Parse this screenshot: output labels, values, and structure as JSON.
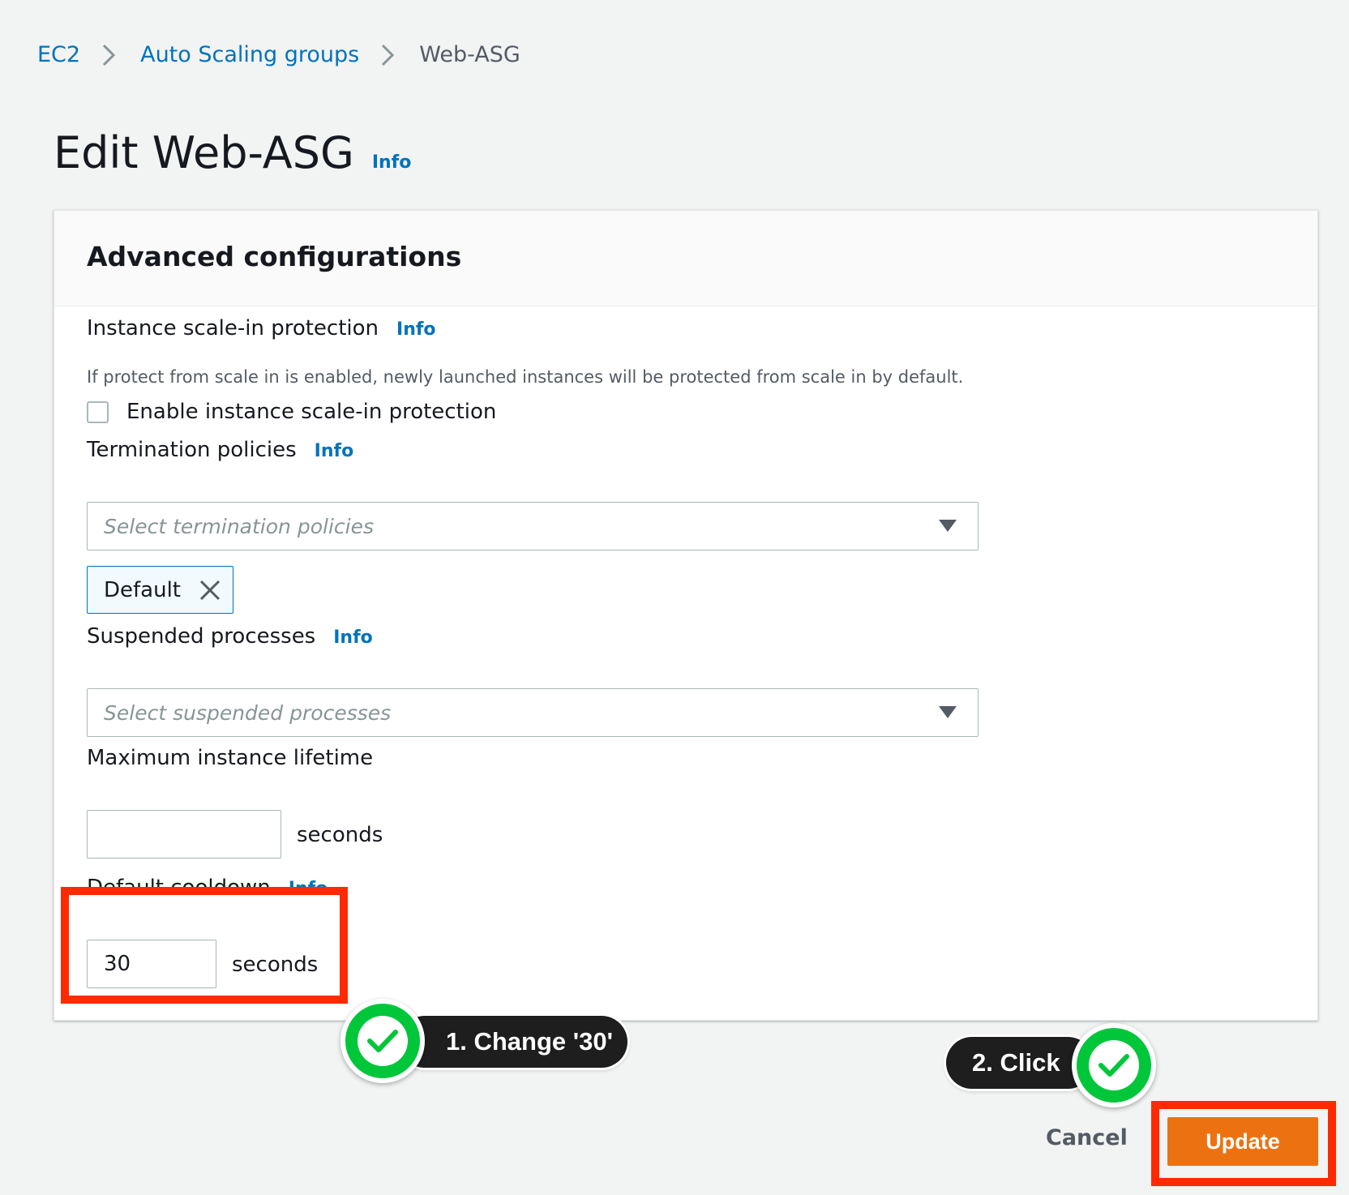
{
  "breadcrumb": {
    "items": [
      {
        "label": "EC2"
      },
      {
        "label": "Auto Scaling groups"
      },
      {
        "label": "Web-ASG"
      }
    ]
  },
  "page": {
    "title": "Edit Web-ASG",
    "info": "Info"
  },
  "panel": {
    "title": "Advanced configurations",
    "scale_in": {
      "label": "Instance scale-in protection",
      "info": "Info",
      "description": "If protect from scale in is enabled, newly launched instances will be protected from scale in by default.",
      "checkbox_label": "Enable instance scale-in protection",
      "checked": false
    },
    "termination": {
      "label": "Termination policies",
      "info": "Info",
      "placeholder": "Select termination policies",
      "tokens": [
        "Default"
      ]
    },
    "suspended": {
      "label": "Suspended processes",
      "info": "Info",
      "placeholder": "Select suspended processes"
    },
    "lifetime": {
      "label": "Maximum instance lifetime",
      "value": "",
      "unit": "seconds"
    },
    "cooldown": {
      "label": "Default cooldown",
      "info": "Info",
      "value": "30",
      "unit": "seconds"
    }
  },
  "actions": {
    "cancel": "Cancel",
    "update": "Update"
  },
  "annotations": {
    "step1": "1. Change '30'",
    "step2": "2. Click",
    "highlight_color": "#ff2a00",
    "badge_color": "#00c63a"
  },
  "colors": {
    "link": "#0073bb",
    "primary_button": "#ec7211",
    "background": "#f2f3f3"
  }
}
